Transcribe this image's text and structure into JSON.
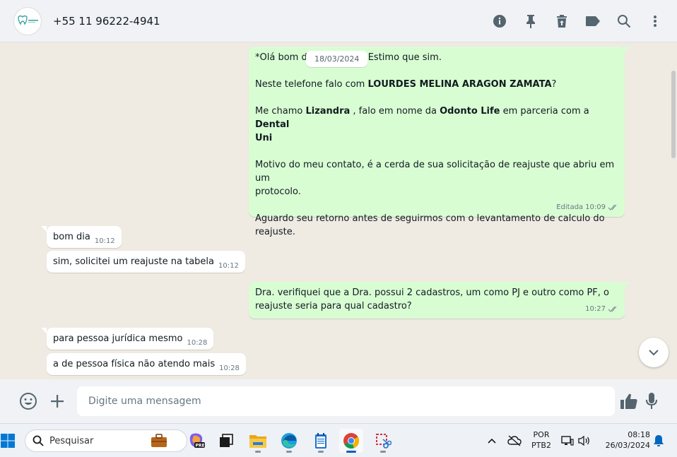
{
  "header": {
    "contact": "+55 11 96222-4941",
    "icons": [
      "info-icon",
      "pin-icon",
      "delete-icon",
      "label-icon",
      "search-icon",
      "menu-icon"
    ]
  },
  "chat": {
    "date_chip": "18/03/2024",
    "messages": [
      {
        "direction": "out",
        "l1a": "*Olá bom d",
        "l1b": "Estimo que sim.",
        "l2a": "Neste telefone falo com ",
        "l2b": "LOURDES MELINA ARAGON ZAMATA",
        "l2c": "?",
        "l3a": "Me chamo ",
        "l3b": "Lizandra",
        "l3c": " , falo em nome da ",
        "l3d": "Odonto Life",
        "l3e": " em parceria com a ",
        "l3f": "Dental",
        "l3g": "Uni",
        "l4": "Motivo do meu contato, é a cerda de sua solicitação de reajuste que abriu em um",
        "l4b": "protocolo.",
        "l5": "Aguardo seu retorno antes de seguirmos com o levantamento de calculo do",
        "l5b": "reajuste.",
        "edited": "Editada",
        "time": "10:09"
      },
      {
        "direction": "in",
        "text": "bom dia",
        "time": "10:12"
      },
      {
        "direction": "in",
        "text": "sim, solicitei um reajuste na tabela",
        "time": "10:12"
      },
      {
        "direction": "out",
        "l1": "Dra. verifiquei que a Dra. possui 2 cadastros, um como PJ e outro como PF, o",
        "l2": "reajuste seria para qual cadastro?",
        "time": "10:27"
      },
      {
        "direction": "in",
        "text": "para pessoa jurídica mesmo",
        "time": "10:28"
      },
      {
        "direction": "in",
        "text": "a de pessoa física não atendo mais",
        "time": "10:28"
      }
    ]
  },
  "composer": {
    "placeholder": "Digite uma mensagem"
  },
  "taskbar": {
    "search_label": "Pesquisar",
    "lang_line1": "POR",
    "lang_line2": "PTB2",
    "time": "08:18",
    "date": "26/03/2024"
  },
  "colors": {
    "outgoing_bubble": "#d9fdd3",
    "incoming_bubble": "#ffffff",
    "chat_background": "#efeae2",
    "read_ticks": "#8696a0"
  }
}
